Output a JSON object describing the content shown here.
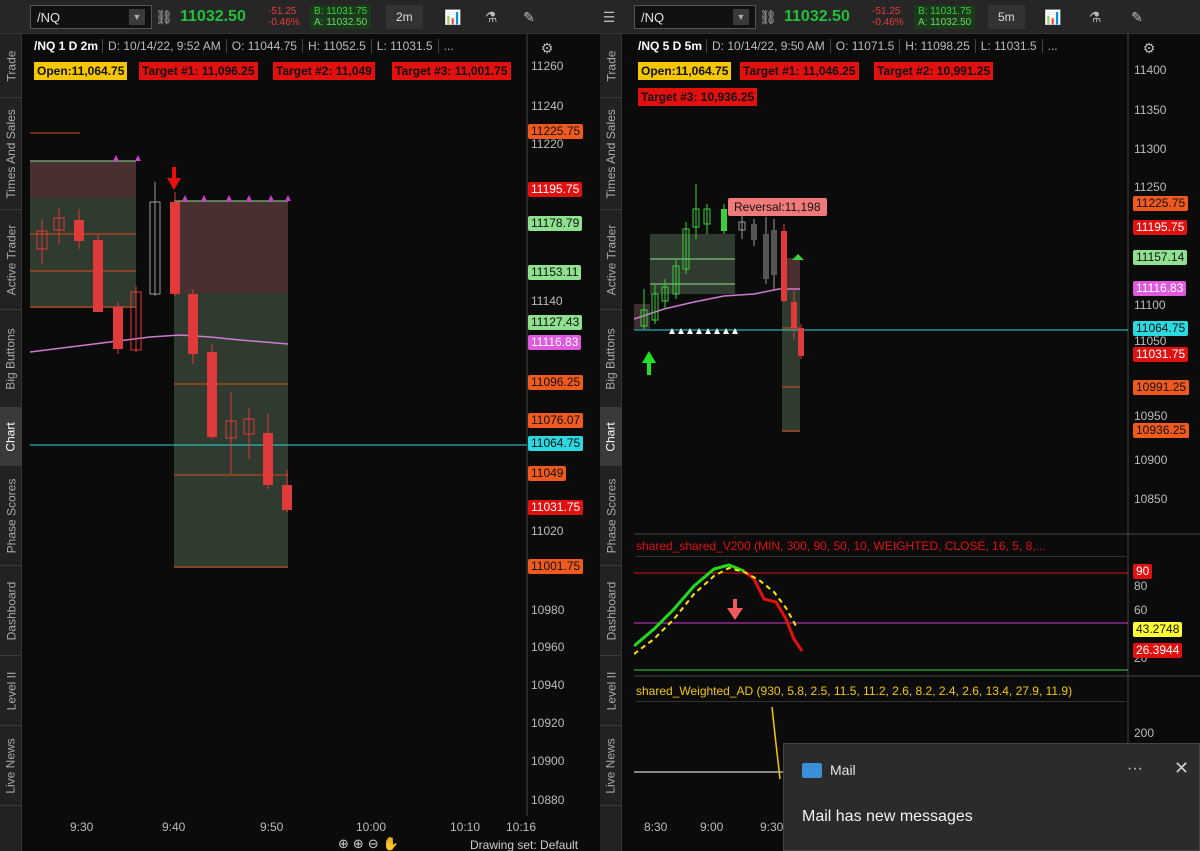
{
  "left": {
    "symbol": "/NQ",
    "last": "11032.50",
    "net_change": "-51.25",
    "net_pct": "-0.46%",
    "bid": "B: 11031.75",
    "ask": "A: 11032.50",
    "timeframe": "2m",
    "info": {
      "sym": "/NQ 1 D 2m",
      "date": "D: 10/14/22, 9:52 AM",
      "open": "O: 11044.75",
      "high": "H: 11052.5",
      "low": "L: 11031.5",
      "more": "..."
    },
    "tags": {
      "open": "Open:11,064.75",
      "t1": "Target #1: 11,096.25",
      "t2": "Target #2: 11,049",
      "t3": "Target #3: 11,001.75"
    },
    "axis_ticks": [
      "11260",
      "11240",
      "11220",
      "11140",
      "11020",
      "10980",
      "10960",
      "10940",
      "10920",
      "10900",
      "10880"
    ],
    "price_labels": [
      {
        "text": "11225.75",
        "bg": "#f05a1e",
        "fg": "#111111"
      },
      {
        "text": "11195.75",
        "bg": "#e31010",
        "fg": "#ffffff"
      },
      {
        "text": "11178.79",
        "bg": "#8fe08f",
        "fg": "#111111"
      },
      {
        "text": "11153.11",
        "bg": "#8fe08f",
        "fg": "#111111"
      },
      {
        "text": "11127.43",
        "bg": "#8fe08f",
        "fg": "#111111"
      },
      {
        "text": "11116.83",
        "bg": "#e05ae0",
        "fg": "#ffffff"
      },
      {
        "text": "11096.25",
        "bg": "#f05a1e",
        "fg": "#111111"
      },
      {
        "text": "11076.07",
        "bg": "#f05a1e",
        "fg": "#111111"
      },
      {
        "text": "11064.75",
        "bg": "#2bd9e0",
        "fg": "#111111"
      },
      {
        "text": "11049",
        "bg": "#f05a1e",
        "fg": "#111111"
      },
      {
        "text": "11031.75",
        "bg": "#e31010",
        "fg": "#ffffff"
      },
      {
        "text": "11001.75",
        "bg": "#f05a1e",
        "fg": "#111111"
      }
    ],
    "time_ticks": [
      "9:30",
      "9:40",
      "9:50",
      "10:00",
      "10:10",
      "10:16"
    ],
    "footer": "Drawing set: Default"
  },
  "right": {
    "symbol": "/NQ",
    "last": "11032.50",
    "net_change": "-51.25",
    "net_pct": "-0.46%",
    "bid": "B: 11031.75",
    "ask": "A: 11032.50",
    "timeframe": "5m",
    "info": {
      "sym": "/NQ 5 D 5m",
      "date": "D: 10/14/22, 9:50 AM",
      "open": "O: 11071.5",
      "high": "H: 11098.25",
      "low": "L: 11031.5",
      "more": "..."
    },
    "tags": {
      "open": "Open:11,064.75",
      "t1": "Target #1: 11,046.25",
      "t2": "Target #2: 10,991.25",
      "t3": "Target #3: 10,936.25"
    },
    "reversal": "Reversal:11,198",
    "axis_ticks": [
      "11400",
      "11350",
      "11300",
      "11250",
      "11100",
      "11050",
      "10950",
      "10900",
      "10850"
    ],
    "price_labels": [
      {
        "text": "11225.75",
        "bg": "#f05a1e",
        "fg": "#111111"
      },
      {
        "text": "11195.75",
        "bg": "#e31010",
        "fg": "#ffffff"
      },
      {
        "text": "11157.14",
        "bg": "#8fe08f",
        "fg": "#111111"
      },
      {
        "text": "11116.83",
        "bg": "#e05ae0",
        "fg": "#ffffff"
      },
      {
        "text": "11064.75",
        "bg": "#2bd9e0",
        "fg": "#111111"
      },
      {
        "text": "11031.75",
        "bg": "#e31010",
        "fg": "#ffffff"
      },
      {
        "text": "10991.25",
        "bg": "#f05a1e",
        "fg": "#111111"
      },
      {
        "text": "10936.25",
        "bg": "#f05a1e",
        "fg": "#111111"
      }
    ],
    "study1": {
      "title": "shared_shared_V200 (MIN, 300, 90, 50, 10, WEIGHTED, CLOSE, 16, 5, 8,...",
      "ticks": [
        "80",
        "60",
        "20"
      ],
      "labels": [
        {
          "text": "90",
          "bg": "#e31010",
          "fg": "#ffffff"
        },
        {
          "text": "43.2748",
          "bg": "#ffff33",
          "fg": "#111111"
        },
        {
          "text": "26.3944",
          "bg": "#e31010",
          "fg": "#ffffff"
        }
      ]
    },
    "study2": {
      "title": "shared_Weighted_AD (930, 5.8, 2.5, 11.5, 11.2, 2.6, 8.2, 2.4, 2.6, 13.4, 27.9, 11.9)",
      "ticks": [
        "200"
      ]
    },
    "time_ticks": [
      "8:30",
      "9:00",
      "9:30"
    ]
  },
  "sidetabs": [
    "Trade",
    "Times And Sales",
    "Active Trader",
    "Big Buttons",
    "Chart",
    "Phase Scores",
    "Dashboard",
    "Level II",
    "Live News"
  ],
  "toast": {
    "app": "Mail",
    "message": "Mail has new messages",
    "more": "···",
    "close": "✕"
  }
}
